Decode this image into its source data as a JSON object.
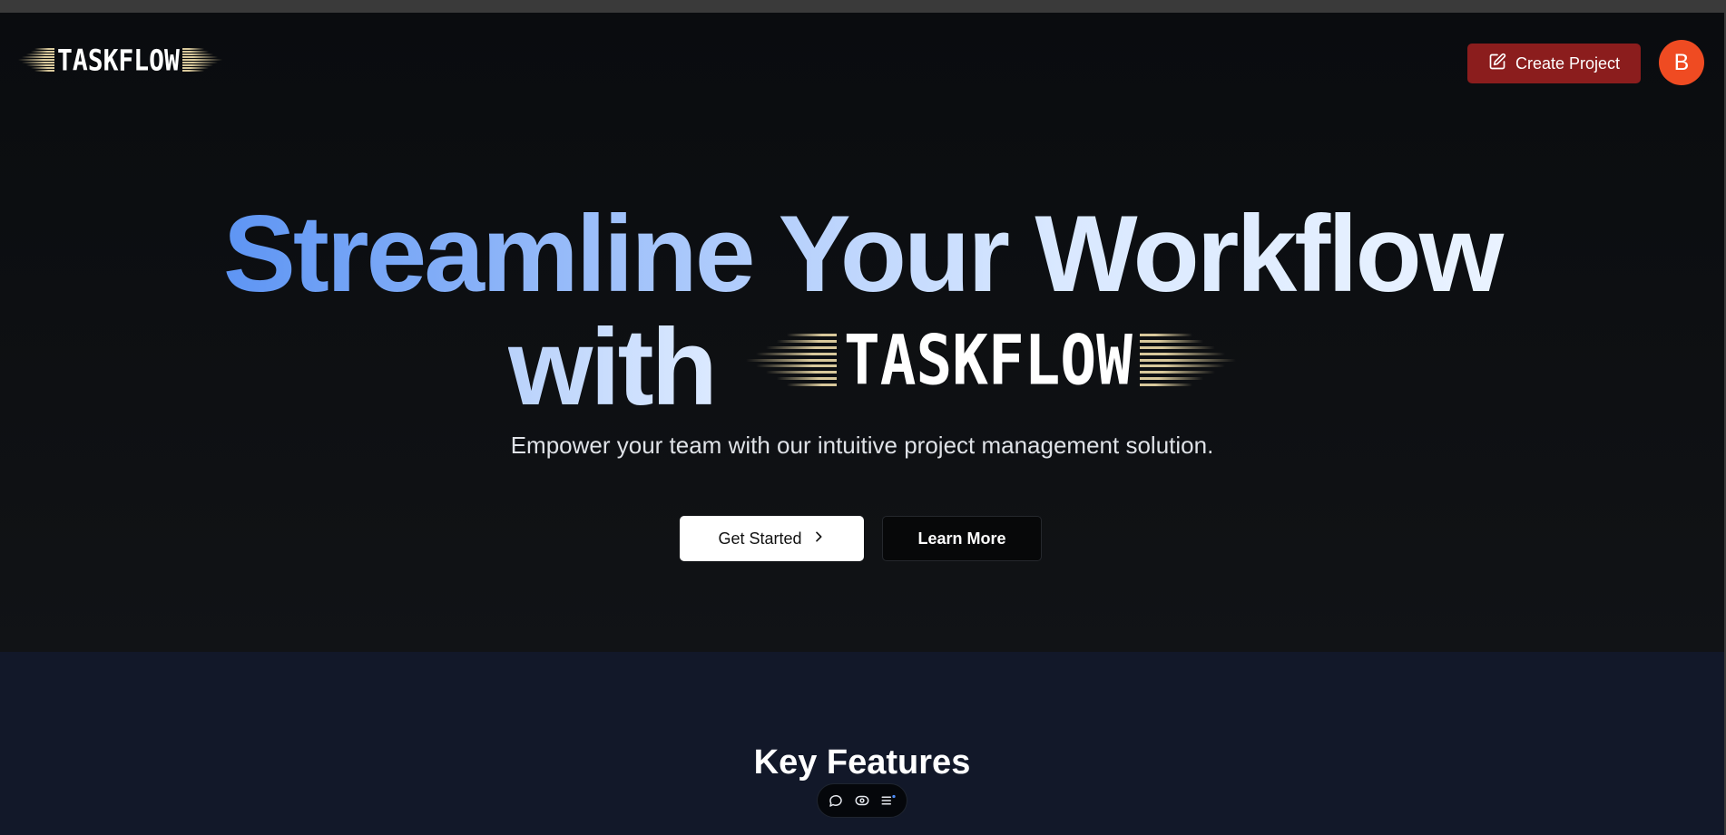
{
  "header": {
    "logo_text": "TASKFLOW",
    "create_button_label": "Create Project",
    "avatar_initial": "B"
  },
  "hero": {
    "headline_line1": "Streamline Your Workflow",
    "headline_line2_prefix": "with",
    "headline_logo_text": "TASKFLOW",
    "subtitle": "Empower your team with our intuitive project management solution.",
    "primary_button_label": "Get Started",
    "secondary_button_label": "Learn More"
  },
  "features": {
    "title": "Key Features"
  },
  "floating_toolbar": {
    "icons": [
      "chat-icon",
      "eye-icon",
      "list-icon"
    ]
  },
  "colors": {
    "background": "#0b0d10",
    "features_background": "#121829",
    "create_button": "#8b1d1d",
    "avatar": "#ef4b22",
    "gradient_start": "#5b93f3",
    "gradient_end": "#eaf3ff",
    "logo_lines": "#d8c89b"
  }
}
